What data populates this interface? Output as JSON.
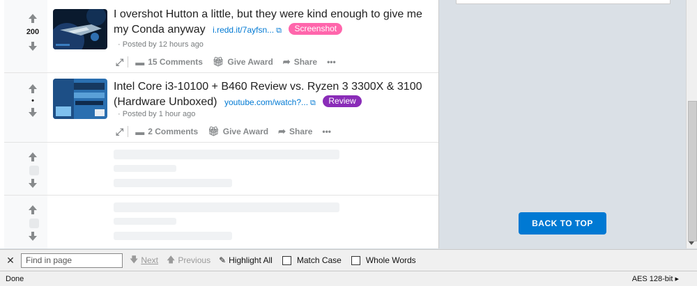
{
  "posts": [
    {
      "score": "200",
      "title": "I overshot Hutton a little, but they were kind enough to give me my Conda anyway",
      "link": "i.redd.it/7ayfsn...",
      "flair": "Screenshot",
      "flair_color": "#ff66ac",
      "posted": "Posted by 12 hours ago",
      "comments": "15 Comments",
      "award": "Give Award",
      "share": "Share"
    },
    {
      "score": "•",
      "title": "Intel Core i3-10100 + B460 Review vs. Ryzen 3 3300X & 3100 (Hardware Unboxed)",
      "link": "youtube.com/watch?...",
      "flair": "Review",
      "flair_color": "#8a2cb8",
      "posted": "Posted by 1 hour ago",
      "comments": "2 Comments",
      "award": "Give Award",
      "share": "Share"
    }
  ],
  "back_to_top": "BACK TO TOP",
  "findbar": {
    "close": "✕",
    "placeholder": "Find in page",
    "next": "Next",
    "previous": "Previous",
    "highlight_all": "Highlight All",
    "match_case": "Match Case",
    "whole_words": "Whole Words"
  },
  "status": {
    "text": "Done",
    "security": "AES 128-bit"
  },
  "colors": {
    "accent": "#0079d3",
    "background": "#dae0e6"
  }
}
